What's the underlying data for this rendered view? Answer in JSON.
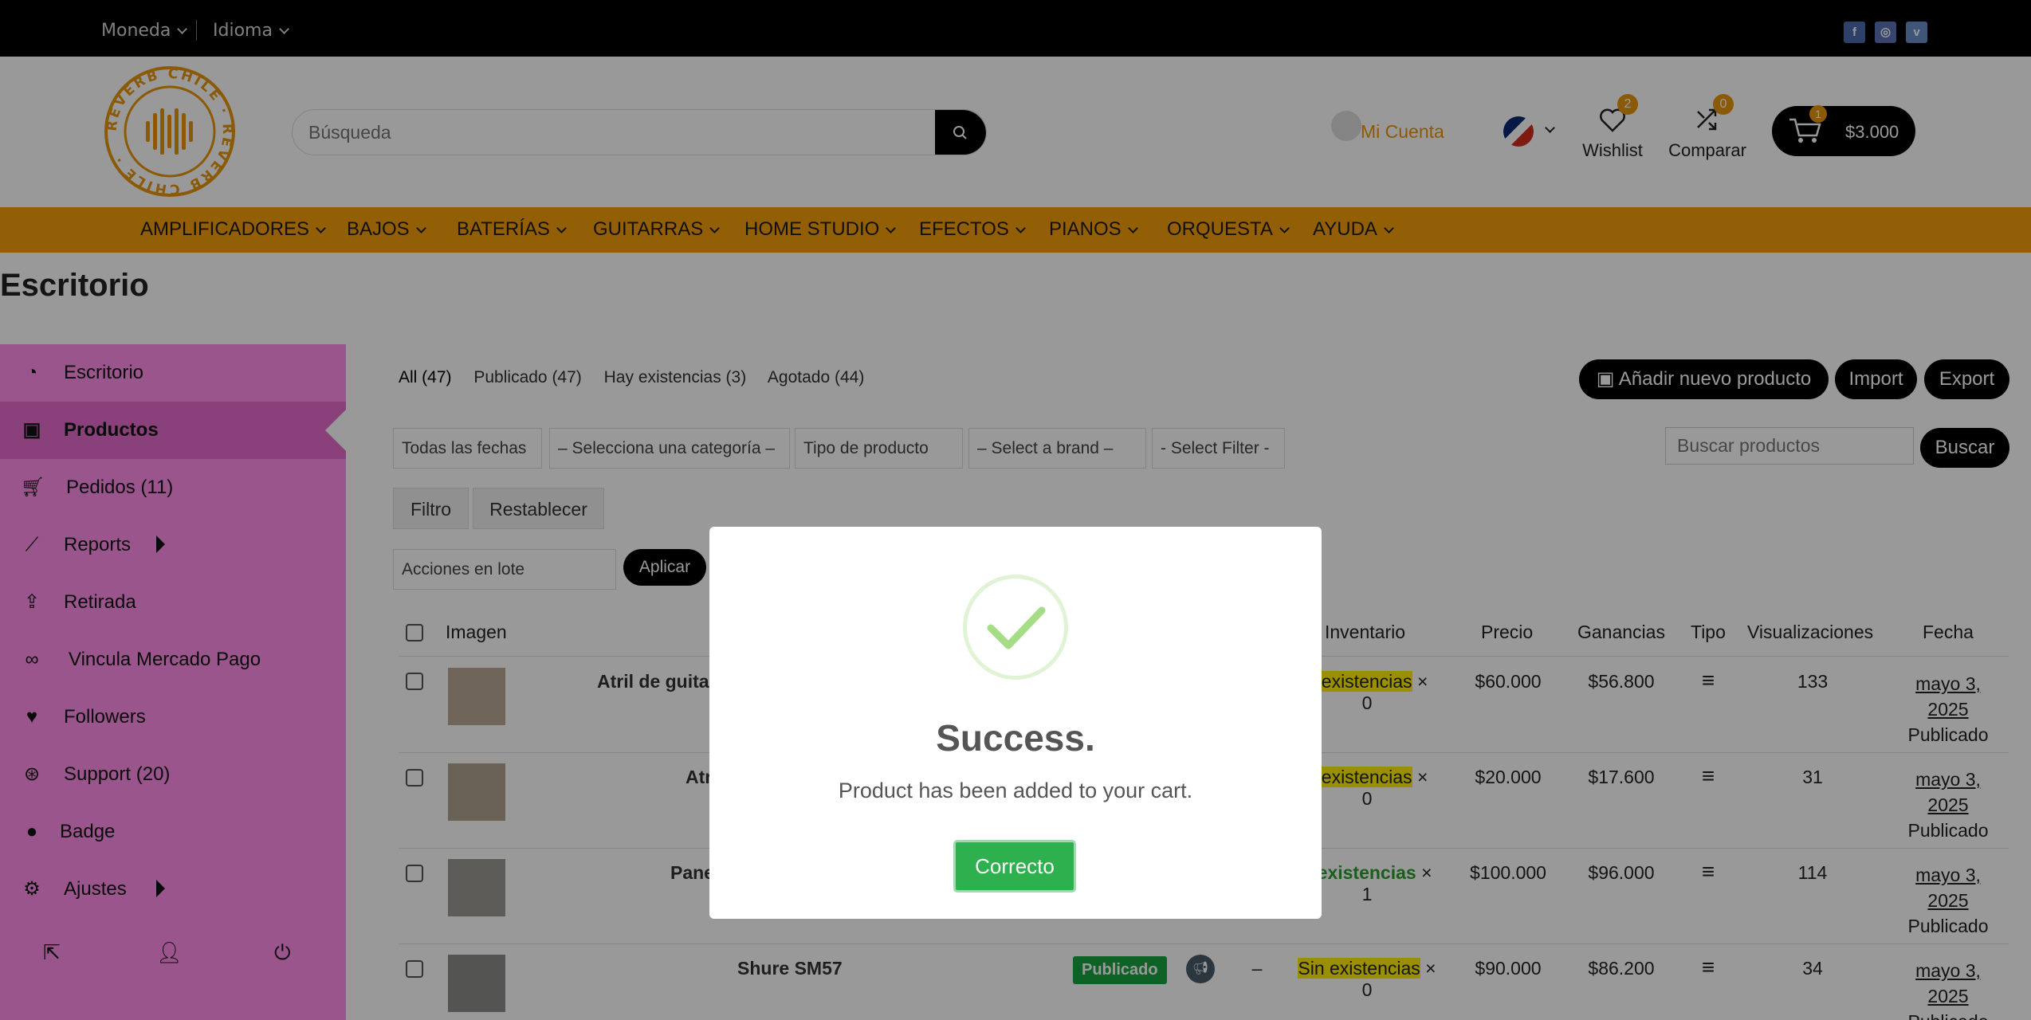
{
  "topbar": {
    "currency": "Moneda",
    "language": "Idioma",
    "social": [
      "facebook-icon",
      "instagram-icon",
      "vimeo-icon"
    ]
  },
  "header": {
    "logo_text": "REVERB CHILE",
    "search_placeholder": "Búsqueda",
    "account_label": "Mi Cuenta",
    "wishlist_label": "Wishlist",
    "wishlist_count": "2",
    "compare_label": "Comparar",
    "compare_count": "0",
    "cart_count": "1",
    "cart_amount": "$3.000"
  },
  "nav": [
    "AMPLIFICADORES",
    "BAJOS",
    "BATERÍAS",
    "GUITARRAS",
    "HOME STUDIO",
    "EFECTOS",
    "PIANOS",
    "ORQUESTA",
    "AYUDA"
  ],
  "page_title": "Escritorio",
  "sidebar": {
    "items": [
      {
        "label": "Escritorio",
        "icon": "dashboard-icon"
      },
      {
        "label": "Productos",
        "icon": "briefcase-icon"
      },
      {
        "label": "Pedidos (11)",
        "icon": "cart-icon"
      },
      {
        "label": "Reports",
        "icon": "chart-line-icon"
      },
      {
        "label": "Retirada",
        "icon": "upload-icon"
      },
      {
        "label": "Vincula Mercado Pago",
        "icon": "link-icon"
      },
      {
        "label": "Followers",
        "icon": "heart-icon"
      },
      {
        "label": "Support (20)",
        "icon": "lifebuoy-icon"
      },
      {
        "label": "Badge",
        "icon": "badge-icon"
      },
      {
        "label": "Ajustes",
        "icon": "gear-icon"
      }
    ]
  },
  "products": {
    "status_links": [
      "All (47)",
      "Publicado (47)",
      "Hay existencias (3)",
      "Agotado (44)"
    ],
    "add_button": "Añadir nuevo producto",
    "import_button": "Import",
    "export_button": "Export",
    "filters": [
      "Todas las fechas",
      "– Selecciona una categoría –",
      "Tipo de producto",
      "– Select a brand –",
      "- Select Filter -"
    ],
    "search_placeholder": "Buscar productos",
    "search_button": "Buscar",
    "filter_button": "Filtro",
    "reset_button": "Restablecer",
    "bulk_actions": "Acciones en lote",
    "apply_button": "Aplicar",
    "columns": {
      "image": "Imagen",
      "inventory": "Inventario",
      "price": "Precio",
      "earnings": "Ganancias",
      "type": "Tipo",
      "views": "Visualizaciones",
      "date": "Fecha"
    },
    "rows": [
      {
        "name": "Atril de guita",
        "stock": "n existencias",
        "qty": "0",
        "price": "$60.000",
        "earnings": "$56.800",
        "views": "133",
        "date1": "mayo 3,",
        "date2": "2025",
        "status": "Publicado"
      },
      {
        "name": "Atr",
        "stock": "n existencias",
        "qty": "0",
        "price": "$20.000",
        "earnings": "$17.600",
        "views": "31",
        "date1": "mayo 3,",
        "date2": "2025",
        "status": "Publicado"
      },
      {
        "name": "Pane",
        "stock": "y existencias",
        "qty": "1",
        "price": "$100.000",
        "earnings": "$96.000",
        "views": "114",
        "date1": "mayo 3,",
        "date2": "2025",
        "status": "Publicado"
      },
      {
        "name": "Shure SM57",
        "stock": "Sin existencias",
        "qty": "0",
        "price": "$90.000",
        "earnings": "$86.200",
        "views": "34",
        "date1": "mayo 3,",
        "date2": "2025",
        "status": "Publicado",
        "badge": "Publicado",
        "dash": "–"
      }
    ]
  },
  "modal": {
    "title": "Success.",
    "message": "Product has been added to your cart.",
    "button": "Correcto"
  }
}
